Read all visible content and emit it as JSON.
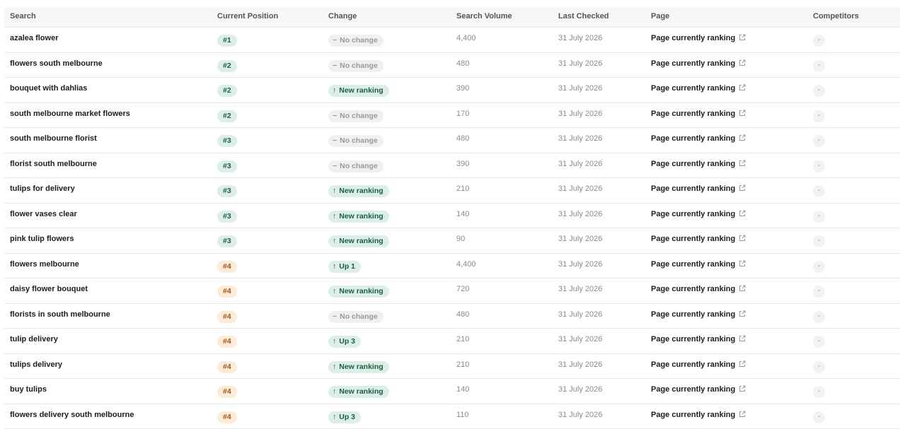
{
  "headers": {
    "search": "Search",
    "position": "Current Position",
    "change": "Change",
    "volume": "Search Volume",
    "checked": "Last Checked",
    "page": "Page",
    "competitors": "Competitors"
  },
  "colors": {
    "green_badge_bg": "#dcefe6",
    "green_badge_text": "#1b5e44",
    "orange_badge_bg": "#fdebd6",
    "orange_badge_text": "#a0561b",
    "neutral_badge_bg": "#f0f0f0"
  },
  "rows": [
    {
      "search": "azalea flower",
      "position": "#1",
      "position_tone": "green",
      "change": "No change",
      "change_type": "none",
      "volume": "4,400",
      "checked": "31 July 2026",
      "page": "Page currently ranking",
      "competitors": "-"
    },
    {
      "search": "flowers south melbourne",
      "position": "#2",
      "position_tone": "green",
      "change": "No change",
      "change_type": "none",
      "volume": "480",
      "checked": "31 July 2026",
      "page": "Page currently ranking",
      "competitors": "-"
    },
    {
      "search": "bouquet with dahlias",
      "position": "#2",
      "position_tone": "green",
      "change": "New ranking",
      "change_type": "up",
      "volume": "390",
      "checked": "31 July 2026",
      "page": "Page currently ranking",
      "competitors": "-"
    },
    {
      "search": "south melbourne market flowers",
      "position": "#2",
      "position_tone": "green",
      "change": "No change",
      "change_type": "none",
      "volume": "170",
      "checked": "31 July 2026",
      "page": "Page currently ranking",
      "competitors": "-"
    },
    {
      "search": "south melbourne florist",
      "position": "#3",
      "position_tone": "green",
      "change": "No change",
      "change_type": "none",
      "volume": "480",
      "checked": "31 July 2026",
      "page": "Page currently ranking",
      "competitors": "-"
    },
    {
      "search": "florist south melbourne",
      "position": "#3",
      "position_tone": "green",
      "change": "No change",
      "change_type": "none",
      "volume": "390",
      "checked": "31 July 2026",
      "page": "Page currently ranking",
      "competitors": "-"
    },
    {
      "search": "tulips for delivery",
      "position": "#3",
      "position_tone": "green",
      "change": "New ranking",
      "change_type": "up",
      "volume": "210",
      "checked": "31 July 2026",
      "page": "Page currently ranking",
      "competitors": "-"
    },
    {
      "search": "flower vases clear",
      "position": "#3",
      "position_tone": "green",
      "change": "New ranking",
      "change_type": "up",
      "volume": "140",
      "checked": "31 July 2026",
      "page": "Page currently ranking",
      "competitors": "-"
    },
    {
      "search": "pink tulip flowers",
      "position": "#3",
      "position_tone": "green",
      "change": "New ranking",
      "change_type": "up",
      "volume": "90",
      "checked": "31 July 2026",
      "page": "Page currently ranking",
      "competitors": "-"
    },
    {
      "search": "flowers melbourne",
      "position": "#4",
      "position_tone": "orange",
      "change": "Up 1",
      "change_type": "up",
      "volume": "4,400",
      "checked": "31 July 2026",
      "page": "Page currently ranking",
      "competitors": "-"
    },
    {
      "search": "daisy flower bouquet",
      "position": "#4",
      "position_tone": "orange",
      "change": "New ranking",
      "change_type": "up",
      "volume": "720",
      "checked": "31 July 2026",
      "page": "Page currently ranking",
      "competitors": "-"
    },
    {
      "search": "florists in south melbourne",
      "position": "#4",
      "position_tone": "orange",
      "change": "No change",
      "change_type": "none",
      "volume": "480",
      "checked": "31 July 2026",
      "page": "Page currently ranking",
      "competitors": "-"
    },
    {
      "search": "tulip delivery",
      "position": "#4",
      "position_tone": "orange",
      "change": "Up 3",
      "change_type": "up",
      "volume": "210",
      "checked": "31 July 2026",
      "page": "Page currently ranking",
      "competitors": "-"
    },
    {
      "search": "tulips delivery",
      "position": "#4",
      "position_tone": "orange",
      "change": "New ranking",
      "change_type": "up",
      "volume": "210",
      "checked": "31 July 2026",
      "page": "Page currently ranking",
      "competitors": "-"
    },
    {
      "search": "buy tulips",
      "position": "#4",
      "position_tone": "orange",
      "change": "New ranking",
      "change_type": "up",
      "volume": "140",
      "checked": "31 July 2026",
      "page": "Page currently ranking",
      "competitors": "-"
    },
    {
      "search": "flowers delivery south melbourne",
      "position": "#4",
      "position_tone": "orange",
      "change": "Up 3",
      "change_type": "up",
      "volume": "110",
      "checked": "31 July 2026",
      "page": "Page currently ranking",
      "competitors": "-"
    }
  ]
}
